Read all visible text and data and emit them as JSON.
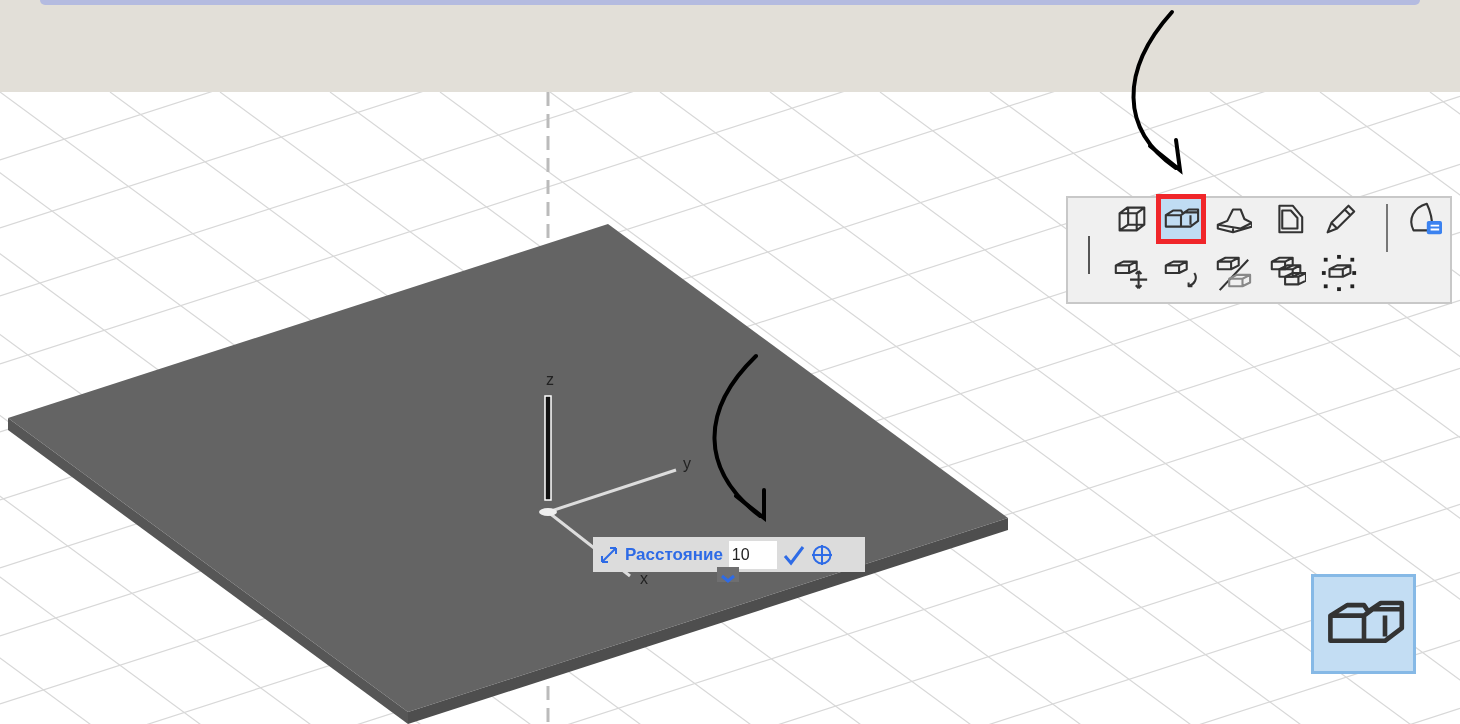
{
  "viewport": {
    "axes": [
      {
        "label": "z"
      },
      {
        "label": "y"
      },
      {
        "label": "x"
      }
    ]
  },
  "toolbar": {
    "tools": [
      {
        "selected": false
      },
      {
        "selected": true
      },
      {
        "selected": false
      },
      {
        "selected": false
      },
      {
        "selected": false
      },
      {
        "selected": false
      },
      {
        "selected": false
      },
      {
        "selected": false
      },
      {
        "selected": false
      },
      {
        "selected": false
      },
      {
        "selected": false
      }
    ]
  },
  "distance_input": {
    "label": "Расстояние",
    "value": "10",
    "expanded": false
  }
}
